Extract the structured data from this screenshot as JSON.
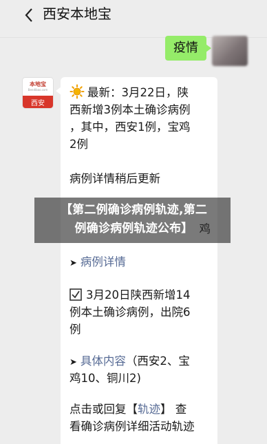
{
  "header": {
    "title": "西安本地宝"
  },
  "outgoing": {
    "text": "疫情"
  },
  "sender": {
    "logo_text": "本地宝",
    "logo_url": "Bendibao.com",
    "logo_city": "西安"
  },
  "message": {
    "line1_a": "最新：3月22日，陕",
    "line1_b": "西新增3例本土确诊病例",
    "line1_c": "，其中，西安1例，宝鸡",
    "line1_d": "2例",
    "line2": "病例详情稍后更新",
    "line3_prefix": "",
    "line3_tail": "鸡",
    "link1": "病例详情",
    "box_a": "3月20日陕西新增14",
    "box_b": "例本土确诊病例，出院6",
    "box_c": "例",
    "link2": "具体内容",
    "detail_a": "（西安2、宝",
    "detail_b": "鸡10、铜川2)",
    "reply_a": "点击或回复【",
    "reply_link": "轨迹",
    "reply_b": "】 查",
    "reply_c": "看确诊病例详细活动轨迹"
  },
  "overlay": {
    "line1": "【第二例确诊病例轨迹,第二",
    "line2": "例确诊病例轨迹公布】"
  },
  "colors": {
    "bubble_out": "#95ec69",
    "link": "#576b95",
    "brand_red": "#d8362a"
  }
}
